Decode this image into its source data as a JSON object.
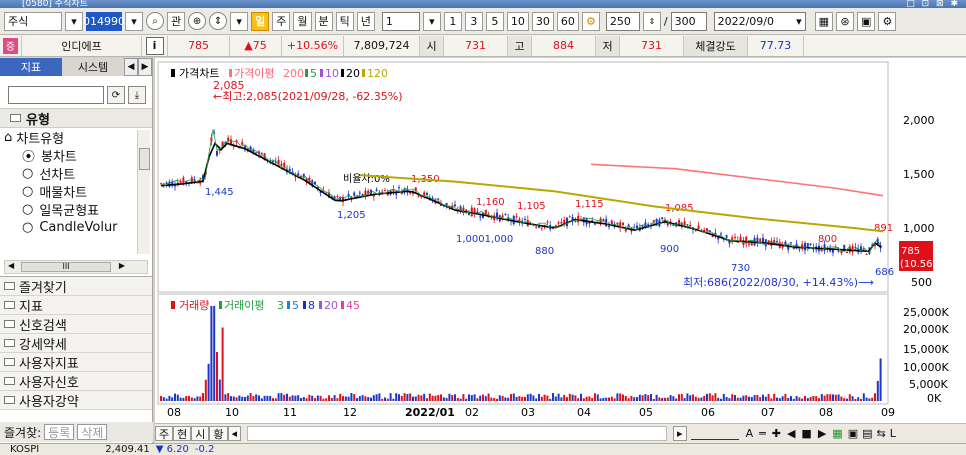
{
  "titlebar": {
    "title": "[0580] 주식차트",
    "icons": "□ ⊡ ⊠ ✱"
  },
  "toolbar": {
    "market": "주식",
    "code": "014990",
    "btn_gwan": "관",
    "period_label_day": "일",
    "periods": [
      "주",
      "월",
      "분",
      "틱",
      "년"
    ],
    "interval_value": "1",
    "minute_buttons": [
      "1",
      "3",
      "5",
      "10",
      "30",
      "60"
    ],
    "count_value": "250",
    "slash": "/",
    "total_value": "300",
    "date_value": "2022/09/0",
    "right_icons": [
      "table-icon",
      "magnify-icon",
      "disk-icon",
      "settings-icon"
    ]
  },
  "infobar": {
    "badge": "증",
    "name": "인디에프",
    "i_label": "i",
    "price": "785",
    "change": "▲75",
    "change_pct": "+10.56%",
    "volume": "7,809,724",
    "open_label": "시",
    "open": "731",
    "high_label": "고",
    "high": "884",
    "low_label": "저",
    "low": "731",
    "strength_label": "체결강도",
    "strength": "77.73"
  },
  "sidebar": {
    "tabs": [
      "지표",
      "시스템"
    ],
    "section_title": "유형",
    "tree_root": "차트유형",
    "options": [
      "봉차트",
      "선차트",
      "매물차트",
      "일목균형표",
      "CandleVolur"
    ],
    "scroll_label": "III",
    "menu": [
      "즐겨찾기",
      "지표",
      "신호검색",
      "강세약세",
      "사용자지표",
      "사용자신호",
      "사용자강약"
    ],
    "bottom_label": "즐겨찾:",
    "bottom_buttons": [
      "등록",
      "삭제"
    ]
  },
  "chart": {
    "price_legend": {
      "title": "가격차트",
      "ma_title": "가격이평",
      "ma_values": [
        "200",
        "5",
        "10",
        "20",
        "120"
      ]
    },
    "volume_legend": {
      "title": "거래량",
      "ma_title": "거래이평",
      "ma_values": [
        "3",
        "5",
        "8",
        "20",
        "45"
      ]
    },
    "annotations": {
      "max_text": "←최고:2,085(2021/09/28, -62.35%)",
      "min_text": "최저:686(2022/08/30, +14.43%)⟶",
      "ratio_text": "비율차:0%",
      "peak_label": "2,085",
      "labels": [
        {
          "text": "1,445",
          "color": "#1d38c8"
        },
        {
          "text": "1,205",
          "color": "#1d38c8"
        },
        {
          "text": "1,350",
          "color": "#e0101a"
        },
        {
          "text": "1,160",
          "color": "#e0101a"
        },
        {
          "text": "1,105",
          "color": "#e0101a"
        },
        {
          "text": "1,115",
          "color": "#e0101a"
        },
        {
          "text": "1,0001,000",
          "color": "#1d38c8"
        },
        {
          "text": "880",
          "color": "#1d38c8"
        },
        {
          "text": "1,085",
          "color": "#e0101a"
        },
        {
          "text": "900",
          "color": "#1d38c8"
        },
        {
          "text": "730",
          "color": "#1d38c8"
        },
        {
          "text": "800",
          "color": "#e0101a"
        },
        {
          "text": "891",
          "color": "#e0101a"
        },
        {
          "text": "686",
          "color": "#1d38c8"
        }
      ]
    },
    "price_axis": [
      "2,000",
      "1,500",
      "1,000",
      "500"
    ],
    "price_current": "785",
    "price_current_pct": "(10.56%)",
    "volume_axis": [
      "25,000K",
      "20,000K",
      "15,000K",
      "10,000K",
      "5,000K",
      "0K"
    ],
    "x_axis": [
      "08",
      "10",
      "11",
      "12",
      "2022/01",
      "02",
      "03",
      "04",
      "05",
      "06",
      "07",
      "08",
      "09"
    ]
  },
  "bottom_tools": {
    "tabs": [
      "주",
      "현",
      "시",
      "황"
    ],
    "icons": [
      "arrow-left-icon",
      "arrow-right-icon",
      "zoom-bar-icon",
      "text-a-icon",
      "line-icon",
      "plus-icon",
      "prev-icon",
      "stop-icon",
      "next-icon",
      "grid-icon",
      "disk-icon",
      "chart-icon",
      "arrow-left-right-icon",
      "L-icon"
    ]
  },
  "statusbar": {
    "index": "KOSPI",
    "value": "2,409.41",
    "change": "▼ 6.20",
    "pct": "-0.2"
  }
}
